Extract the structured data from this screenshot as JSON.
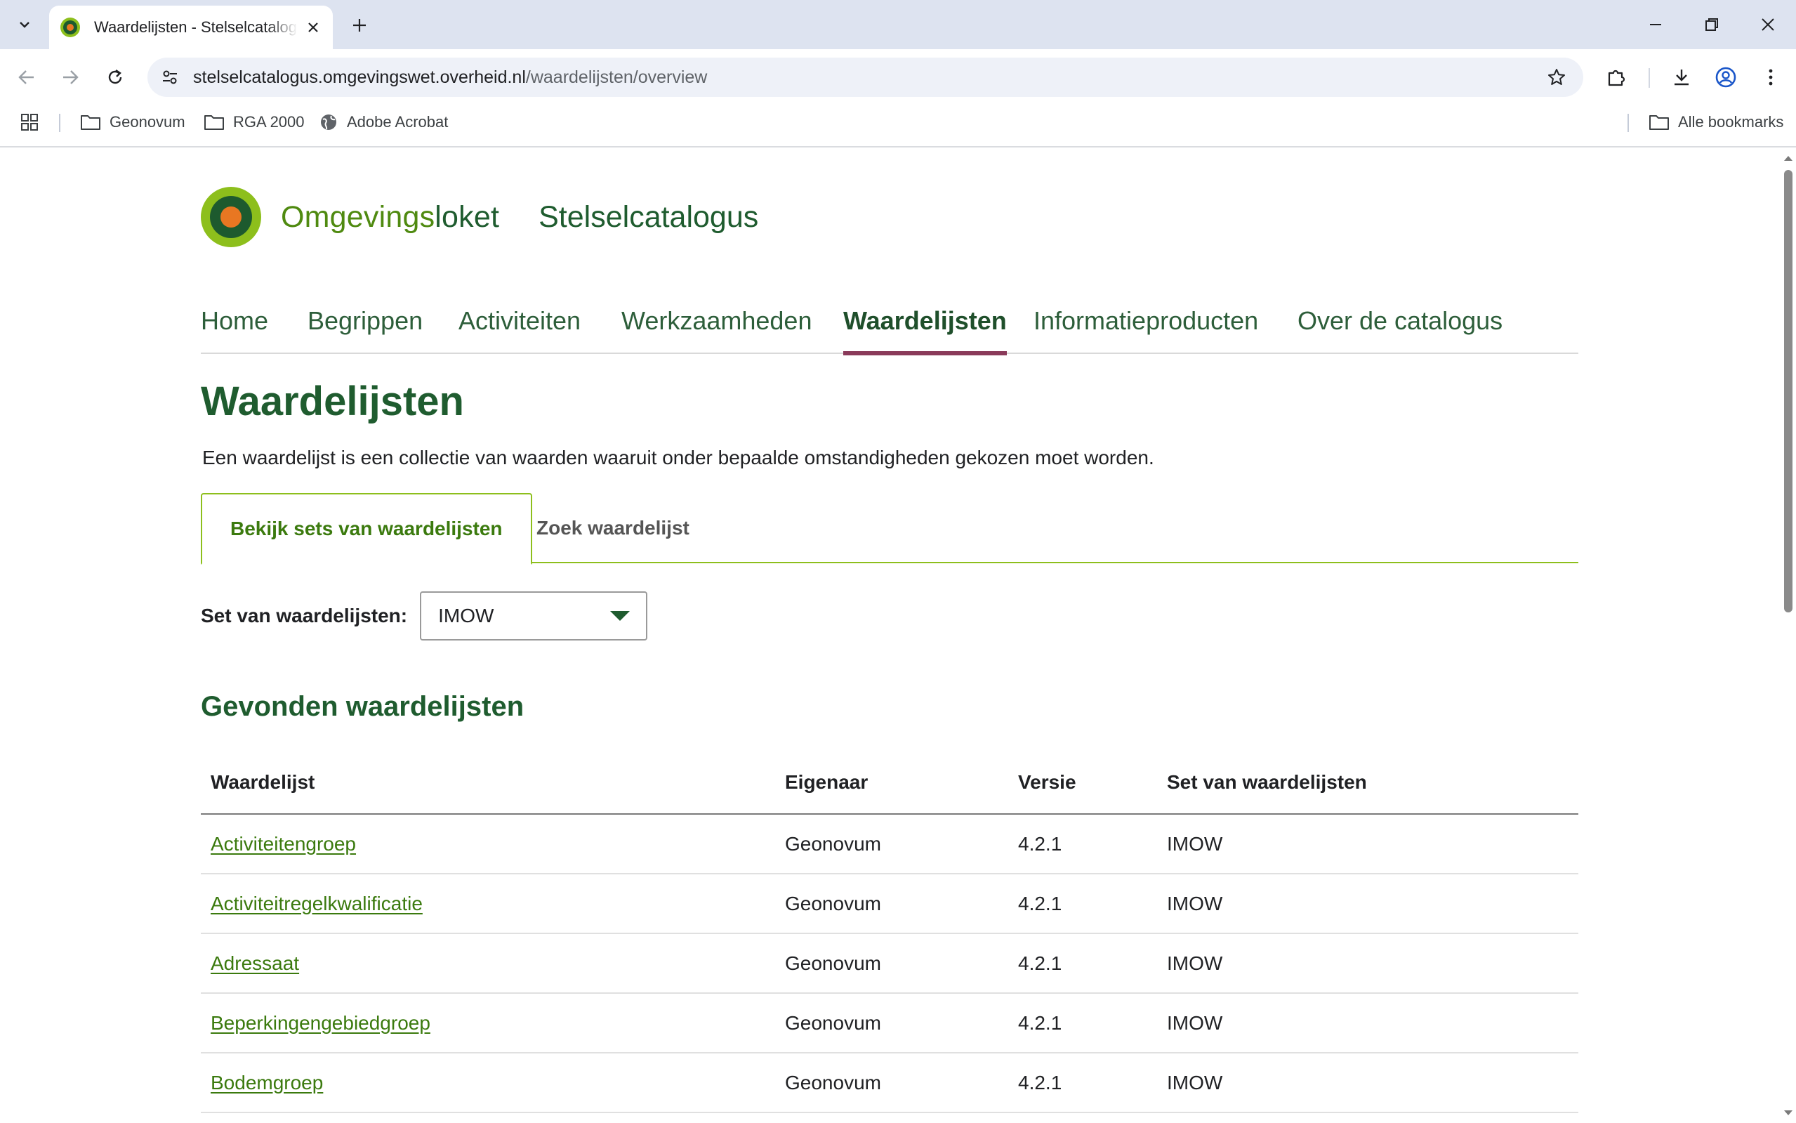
{
  "browser": {
    "tab_title": "Waardelijsten - Stelselcatalogus",
    "url_host": "stelselcatalogus.omgevingswet.overheid.nl",
    "url_path": "/waardelijsten/overview",
    "bookmarks": [
      {
        "label": "Geonovum",
        "icon": "folder-icon"
      },
      {
        "label": "RGA 2000",
        "icon": "folder-icon"
      },
      {
        "label": "Adobe Acrobat",
        "icon": "globe-icon"
      }
    ],
    "all_bookmarks_label": "Alle bookmarks"
  },
  "site": {
    "brand_light": "Omgevings",
    "brand_strong": "loket",
    "subtitle": "Stelselcatalogus",
    "brand_colors": {
      "green_dark": "#1f5c2f",
      "green_light": "#8dbf1c",
      "orange": "#e87722",
      "accent_underline": "#8a3a5a"
    }
  },
  "nav": {
    "items": [
      "Home",
      "Begrippen",
      "Activiteiten",
      "Werkzaamheden",
      "Waardelijsten",
      "Informatieproducten",
      "Over de catalogus"
    ],
    "active": "Waardelijsten"
  },
  "page": {
    "title": "Waardelijsten",
    "intro": "Een waardelijst is een collectie van waarden waaruit onder bepaalde omstandigheden gekozen moet worden.",
    "tabs": [
      "Bekijk sets van waardelijsten",
      "Zoek waardelijst"
    ],
    "active_tab": "Bekijk sets van waardelijsten",
    "set_label": "Set van waardelijsten:",
    "set_value": "IMOW",
    "results_title": "Gevonden waardelijsten"
  },
  "table": {
    "headers": [
      "Waardelijst",
      "Eigenaar",
      "Versie",
      "Set van waardelijsten"
    ],
    "rows": [
      [
        "Activiteitengroep",
        "Geonovum",
        "4.2.1",
        "IMOW"
      ],
      [
        "Activiteitregelkwalificatie",
        "Geonovum",
        "4.2.1",
        "IMOW"
      ],
      [
        "Adressaat",
        "Geonovum",
        "4.2.1",
        "IMOW"
      ],
      [
        "Beperkingengebiedgroep",
        "Geonovum",
        "4.2.1",
        "IMOW"
      ],
      [
        "Bodemgroep",
        "Geonovum",
        "4.2.1",
        "IMOW"
      ]
    ]
  }
}
